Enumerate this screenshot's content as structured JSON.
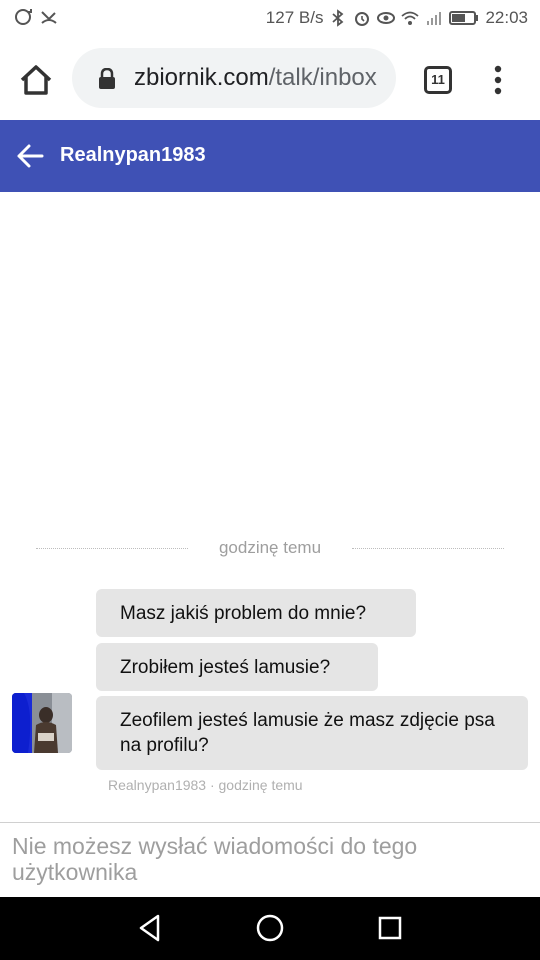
{
  "status_bar": {
    "network_speed": "127 B/s",
    "time": "22:03",
    "icons": [
      "sync-icon",
      "missed-call-icon",
      "bluetooth-icon",
      "alarm-icon",
      "eye-icon",
      "wifi-icon",
      "signal-icon",
      "battery-icon"
    ]
  },
  "browser": {
    "url_domain": "zbiornik.com",
    "url_path": "/talk/inbox",
    "tab_count": "11"
  },
  "header": {
    "title": "Realnypan1983"
  },
  "chat": {
    "divider_label": "godzinę temu",
    "messages": [
      {
        "text": "Masz jakiś problem do mnie?"
      },
      {
        "text": "Zrobiłem jesteś lamusie?"
      },
      {
        "text": "Zeofilem jesteś lamusie że masz zdjęcie psa na profilu?"
      }
    ],
    "meta": "Realnypan1983 · godzinę temu"
  },
  "notice": {
    "text": "Nie możesz wysłać wiadomości do tego użytkownika"
  },
  "colors": {
    "header_bg": "#3f51b5",
    "bubble_bg": "#e5e5e5",
    "nav_bg": "#000000"
  }
}
